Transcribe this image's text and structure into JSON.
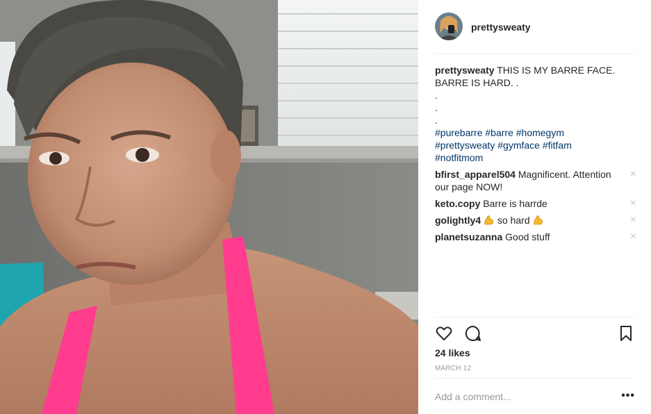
{
  "post": {
    "image_alt_icon": "selfie-photo",
    "author": "prettysweaty",
    "caption": {
      "user": "prettysweaty",
      "text": "THIS IS MY BARRE FACE. BARRE IS HARD. .",
      "dot_lines": [
        ".",
        ".",
        "."
      ],
      "hashtags": [
        "#purebarre",
        "#barre",
        "#homegym",
        "#prettysweaty",
        "#gymface",
        "#fitfam",
        "#notfitmom"
      ]
    },
    "comments": [
      {
        "user": "bfirst_apparel504",
        "text": "Magnificent. Attention our page NOW!",
        "remove": "×"
      },
      {
        "user": "keto.copy",
        "text": "Barre is harrde",
        "remove": "×"
      },
      {
        "user": "golightly4",
        "text_before": "",
        "text_after": "so hard",
        "remove": "×"
      },
      {
        "user": "planetsuzanna",
        "text": "Good stuff",
        "remove": "×"
      }
    ],
    "likes": "24 likes",
    "date": "MARCH 12",
    "add_comment_placeholder": "Add a comment...",
    "more_label": "•••"
  },
  "colors": {
    "hashtag": "#003569",
    "text": "#262626",
    "muted": "#999999",
    "divider": "#efefef"
  }
}
